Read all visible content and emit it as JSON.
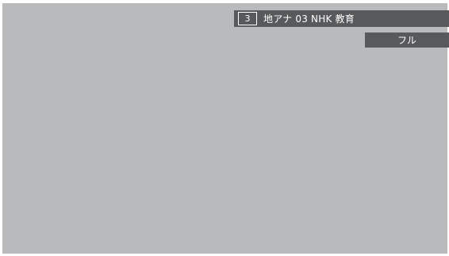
{
  "screen": {
    "background_color": "#b9babc",
    "banner_color": "#58595b"
  },
  "channel_banner": {
    "number": "3",
    "info": "地アナ 03 NHK 教育"
  },
  "mode_badge": {
    "label": "フル"
  }
}
